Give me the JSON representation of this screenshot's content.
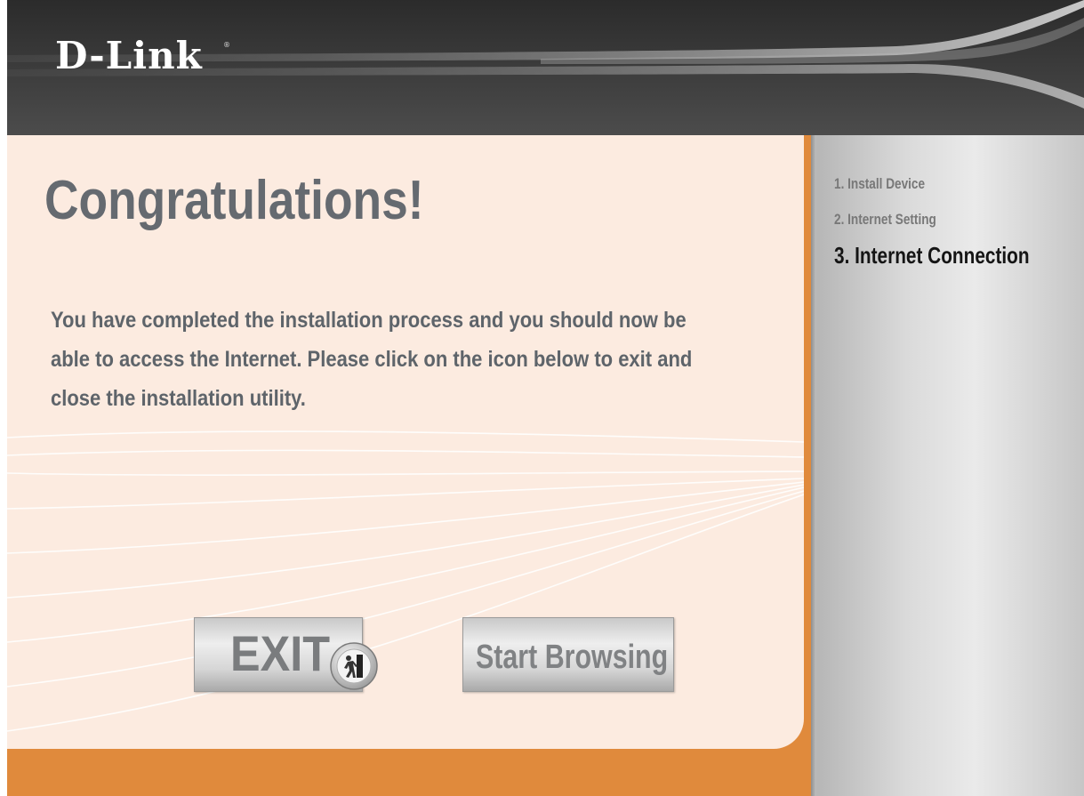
{
  "header": {
    "logo_text": "D-Link",
    "logo_registered": "®"
  },
  "main": {
    "title": "Congratulations!",
    "message": "You have completed the installation process and you should now be able to access the Internet. Please click on the icon below to exit and close the installation utility.",
    "buttons": {
      "exit_label": "EXIT",
      "browse_label": "Start Browsing"
    }
  },
  "sidebar": {
    "steps": [
      {
        "label": "1. Install Device",
        "state": "done"
      },
      {
        "label": "2. Internet Setting",
        "state": "done"
      },
      {
        "label": "3.  Internet Connection",
        "state": "current"
      }
    ]
  },
  "icons": {
    "exit": "exit-door-icon"
  },
  "colors": {
    "header_bg": "#2f2f2f",
    "content_bg": "#fcebe0",
    "accent_orange": "#e08a3c",
    "title_gray": "#656a70",
    "sidebar_gray": "#d8d8d8"
  }
}
